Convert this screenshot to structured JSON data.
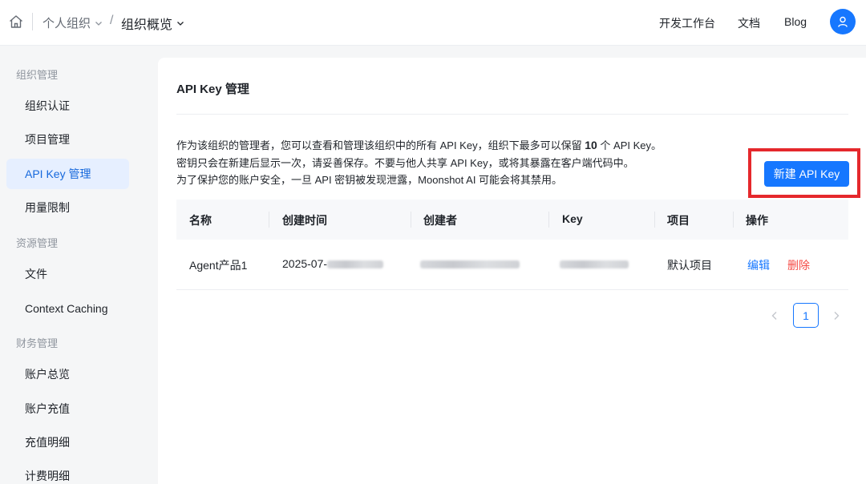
{
  "header": {
    "org_label": "个人组织",
    "breadcrumb_slash": "/",
    "page_label": "组织概览",
    "nav": [
      "开发工作台",
      "文档",
      "Blog"
    ]
  },
  "sidebar": {
    "groups": [
      "组织管理",
      "资源管理",
      "财务管理"
    ],
    "items": [
      "组织认证",
      "项目管理",
      "API Key 管理",
      "用量限制",
      "文件",
      "Context Caching",
      "账户总览",
      "账户充值",
      "充值明细",
      "计费明细"
    ],
    "active_item": "API Key 管理"
  },
  "main": {
    "title": "API Key 管理",
    "desc_line1_prefix": "作为该组织的管理者，您可以查看和管理该组织中的所有 API Key，组织下最多可以保留",
    "desc_line1_count": "10",
    "desc_line1_suffix": "个 API Key。",
    "desc_line2": "密钥只会在新建后显示一次，请妥善保存。不要与他人共享 API Key，或将其暴露在客户端代码中。",
    "desc_line3": "为了保护您的账户安全，一旦 API 密钥被发现泄露，Moonshot AI 可能会将其禁用。",
    "new_button": "新建 API Key"
  },
  "table": {
    "columns": [
      "名称",
      "创建时间",
      "创建者",
      "Key",
      "项目",
      "操作"
    ],
    "rows": [
      {
        "name": "Agent产品1",
        "created_at_visible": "2025-07-",
        "project": "默认项目",
        "edit": "编辑",
        "delete": "删除"
      }
    ]
  },
  "pagination": {
    "current_page": "1"
  },
  "colors": {
    "accent": "#1677ff",
    "danger": "#f54a45",
    "highlight_box": "#e5282c",
    "active_bg": "#e6efff"
  },
  "icons": [
    "home-icon",
    "chevron-down-icon",
    "user-icon",
    "chevron-left-icon",
    "chevron-right-icon"
  ]
}
